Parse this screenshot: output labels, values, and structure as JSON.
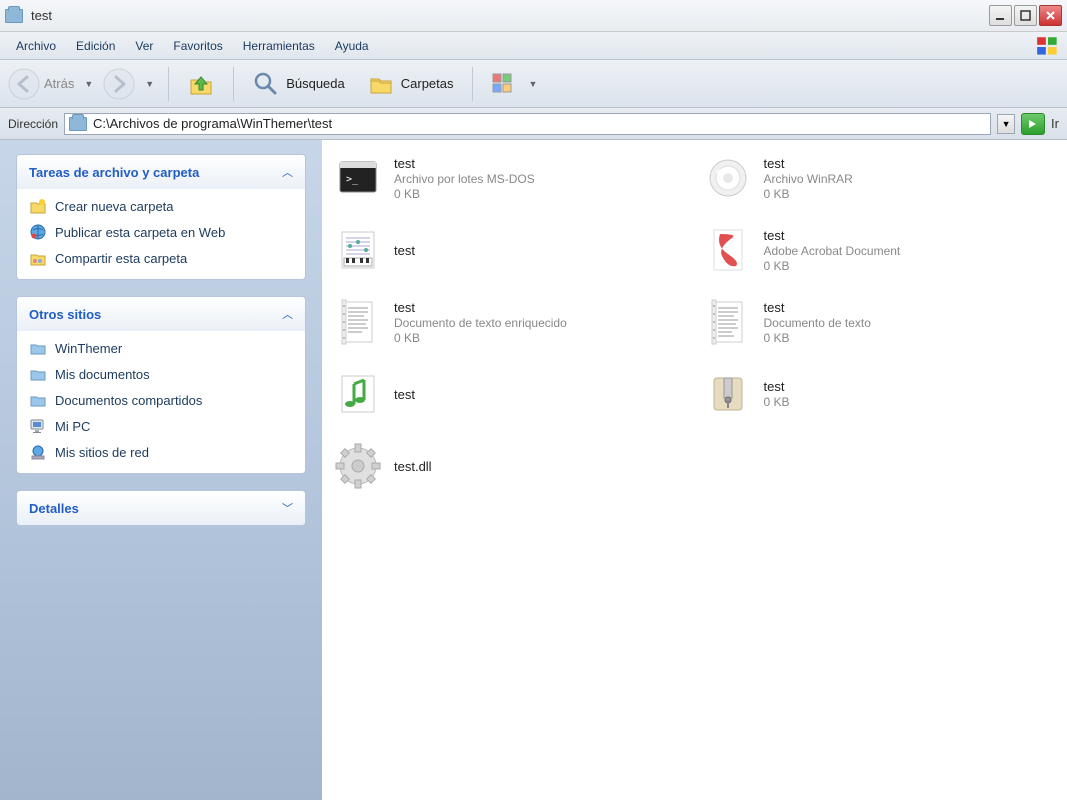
{
  "window": {
    "title": "test"
  },
  "menu": {
    "file": "Archivo",
    "edit": "Edición",
    "view": "Ver",
    "favorites": "Favoritos",
    "tools": "Herramientas",
    "help": "Ayuda"
  },
  "toolbar": {
    "back_label": "Atrás",
    "search_label": "Búsqueda",
    "folders_label": "Carpetas"
  },
  "address": {
    "label": "Dirección",
    "path": "C:\\Archivos de programa\\WinThemer\\test",
    "go_label": "Ir"
  },
  "sidebar": {
    "panel1": {
      "title": "Tareas de archivo y carpeta",
      "links": [
        {
          "label": "Crear nueva carpeta"
        },
        {
          "label": "Publicar esta carpeta en Web"
        },
        {
          "label": "Compartir esta carpeta"
        }
      ]
    },
    "panel2": {
      "title": "Otros sitios",
      "links": [
        {
          "label": "WinThemer"
        },
        {
          "label": "Mis documentos"
        },
        {
          "label": "Documentos compartidos"
        },
        {
          "label": "Mi PC"
        },
        {
          "label": "Mis sitios de red"
        }
      ]
    },
    "panel3": {
      "title": "Detalles"
    }
  },
  "files": [
    {
      "name": "test",
      "type": "Archivo por lotes MS-DOS",
      "size": "0 KB",
      "icon": "bat"
    },
    {
      "name": "test",
      "type": "Archivo WinRAR",
      "size": "0 KB",
      "icon": "rar"
    },
    {
      "name": "test",
      "type": "",
      "size": "",
      "icon": "midi"
    },
    {
      "name": "test",
      "type": "Adobe Acrobat Document",
      "size": "0 KB",
      "icon": "pdf"
    },
    {
      "name": "test",
      "type": "Documento de texto enriquecido",
      "size": "0 KB",
      "icon": "rtf"
    },
    {
      "name": "test",
      "type": "Documento de texto",
      "size": "0 KB",
      "icon": "txt"
    },
    {
      "name": "test",
      "type": "",
      "size": "",
      "icon": "wma"
    },
    {
      "name": "test",
      "type": "",
      "size": "0 KB",
      "icon": "zip"
    },
    {
      "name": "test.dll",
      "type": "",
      "size": "",
      "icon": "dll"
    }
  ]
}
